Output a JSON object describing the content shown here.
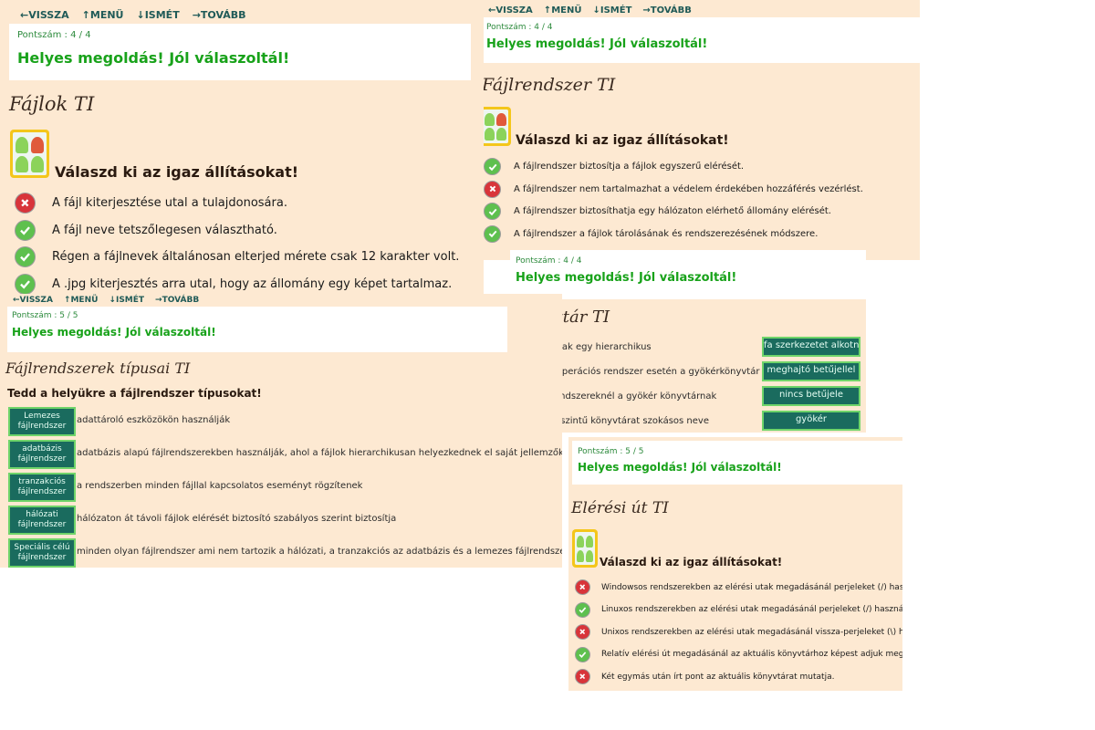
{
  "nav": {
    "back": "VISSZA",
    "menu": "MENÜ",
    "repeat": "ISMÉT",
    "next": "TOVÁBB"
  },
  "nav_icons": [
    "arrow-left-icon",
    "arrow-up-icon",
    "arrow-down-icon",
    "arrow-right-icon"
  ],
  "p1": {
    "score": "Pontszám : 4 / 4",
    "correct": "Helyes megoldás! Jól válaszoltál!",
    "title": "Fájlok TI",
    "question": "Válaszd ki az igaz állításokat!",
    "items": [
      {
        "text": "A fájl kiterjesztése utal a tulajdonosára.",
        "mark": "bad"
      },
      {
        "text": "A fájl neve tetszőlegesen választható.",
        "mark": "ok"
      },
      {
        "text": "Régen a fájlnevek általánosan elterjed mérete csak 12 karakter volt.",
        "mark": "ok"
      },
      {
        "text": "A .jpg kiterjesztés arra utal, hogy az állomány egy képet tartalmaz.",
        "mark": "ok"
      }
    ]
  },
  "p2": {
    "score": "Pontszám : 4 / 4",
    "correct": "Helyes megoldás! Jól válaszoltál!",
    "title": "Fájlrendszer TI",
    "question": "Válaszd ki az igaz állításokat!",
    "items": [
      {
        "text": "A fájlrendszer biztosítja a fájlok egyszerű elérését.",
        "mark": "ok"
      },
      {
        "text": "A fájlrendszer nem tartalmazhat a védelem érdekében hozzáférés vezérlést.",
        "mark": "bad"
      },
      {
        "text": "A fájlrendszer biztosíthatja egy hálózaton elérhető állomány elérését.",
        "mark": "ok"
      },
      {
        "text": "A fájlrendszer a fájlok tárolásának és rendszerezésének módszere.",
        "mark": "ok"
      }
    ]
  },
  "p3": {
    "score": "Pontszám : 5 / 5",
    "correct": "Helyes megoldás! Jól válaszoltál!",
    "title": "Fájlrendszerek típusai TI",
    "question": "Tedd a helyükre a fájlrendszer típusokat!",
    "items": [
      {
        "tag": "Lemezes fájlrendszer",
        "text": "adattároló eszközökön használják"
      },
      {
        "tag": "adatbázis fájlrendszer",
        "text": "adatbázis alapú fájlrendszerekben használják, ahol a fájlok hierarchikusan helyezkednek el saját jellemzőkkel"
      },
      {
        "tag": "tranzakciós fájlrendszer",
        "text": "a rendszerben minden fájllal kapcsolatos eseményt rögzítenek"
      },
      {
        "tag": "hálózati fájlrendszer",
        "text": "hálózaton át távoli fájlok elérését biztosító szabályos szerint biztosítja"
      },
      {
        "tag": "Speciális célú fájlrendszer",
        "text": "minden olyan fájlrendszer ami nem tartozik a hálózati, a tranzakciós az adatbázis és a lemezes fájlrendszerekhez sem"
      }
    ]
  },
  "p4": {
    "score": "Pontszám : 4 / 4",
    "correct": "Helyes megoldás! Jól válaszoltál!",
    "title": "Könyvtár TI",
    "items": [
      {
        "text": "A könyvtárak egy hierarchikus",
        "answer": "fa szerkezetet alkotnak"
      },
      {
        "text": "Windows operációs rendszer esetén a gyökérkönyvtár egy",
        "answer": "meghajtó betűjellel"
      },
      {
        "text": "Linuxos rendszereknél a gyökér könyvtárnak",
        "answer": "nincs betűjele"
      },
      {
        "text": "A legfelső szintű könyvtárat szokásos neve",
        "answer": "gyökér"
      }
    ]
  },
  "p5": {
    "score": "Pontszám : 5 / 5",
    "correct": "Helyes megoldás! Jól válaszoltál!",
    "title": "Elérési út TI",
    "question": "Válaszd ki az igaz állításokat!",
    "items": [
      {
        "text": "Windowsos rendszerekben az elérési utak megadásánál perjeleket (/) hasznaálunk.",
        "mark": "bad"
      },
      {
        "text": "Linuxos rendszerekben az elérési utak megadásánál perjeleket (/) használunk.",
        "mark": "ok"
      },
      {
        "text": "Unixos rendszerekben az elérési utak megadásánál vissza-perjeleket (\\) használunk.",
        "mark": "bad"
      },
      {
        "text": "Relatív elérési út megadásánál az aktuális könyvtárhoz képest adjuk meg az utat.",
        "mark": "ok"
      },
      {
        "text": "Két egymás után írt pont az aktuális könyvtárat mutatja.",
        "mark": "bad"
      }
    ]
  }
}
